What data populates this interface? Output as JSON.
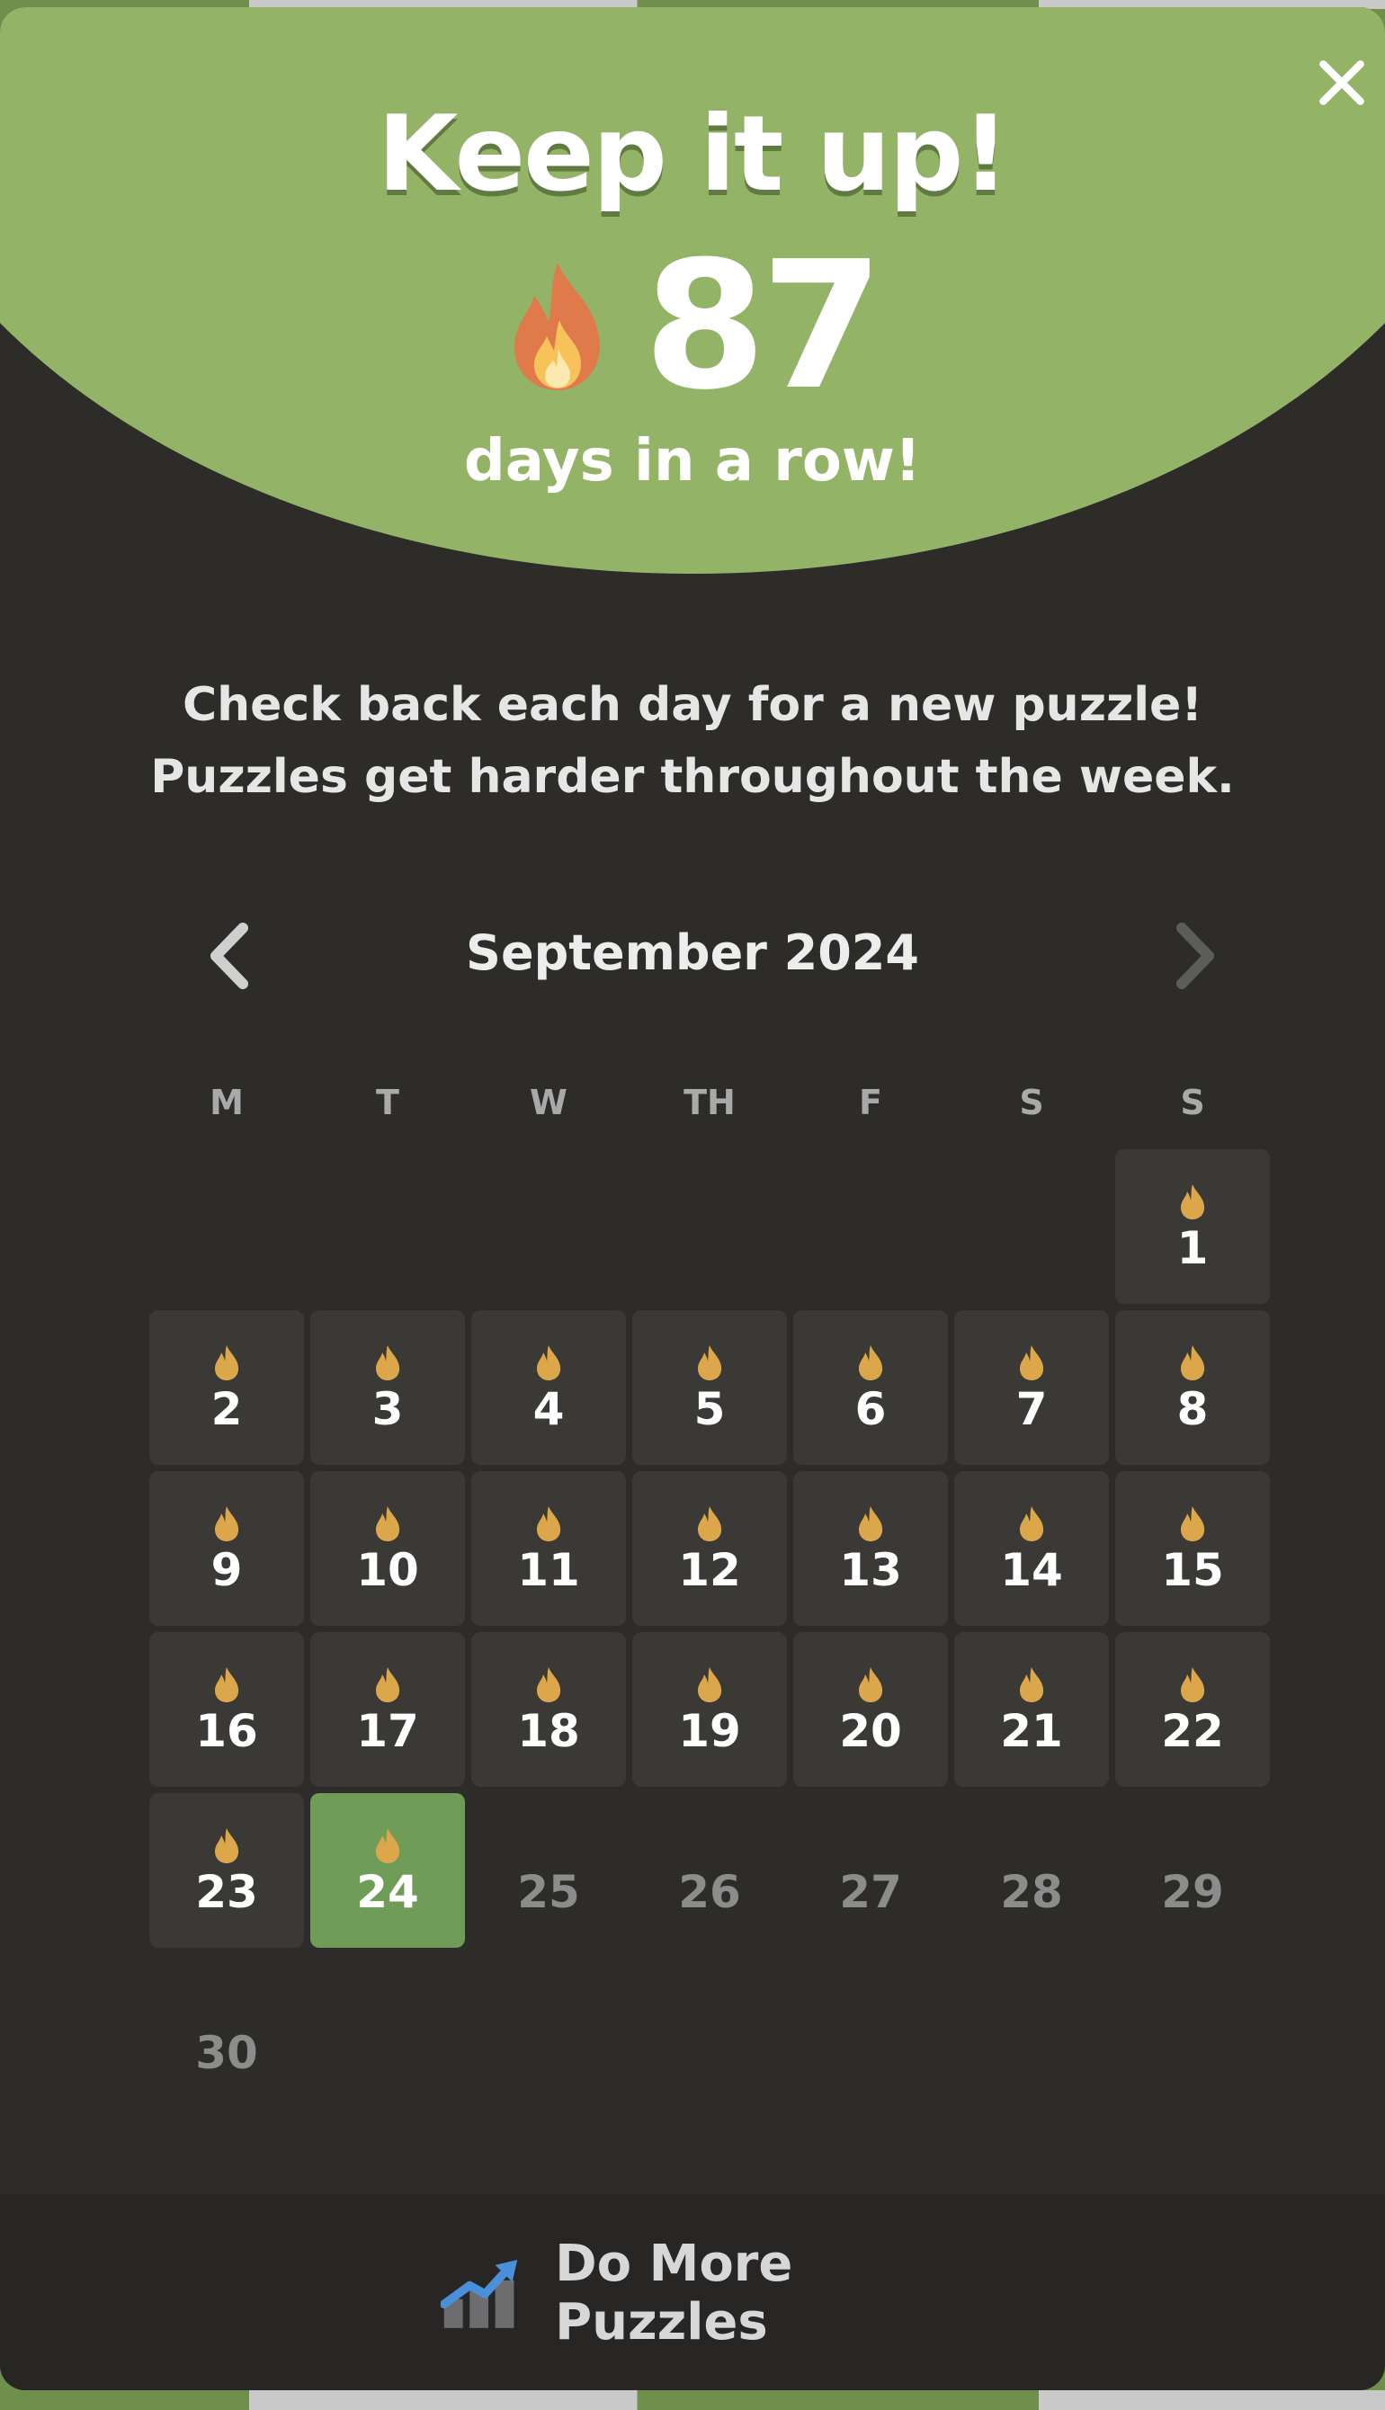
{
  "header": {
    "title": "Keep it up!",
    "streak_count": "87",
    "streak_caption": "days in a row!",
    "close_icon": "close-icon",
    "flame_icon": "flame-icon"
  },
  "description": {
    "line1": "Check back each day for a new puzzle!",
    "line2": "Puzzles get harder throughout the week."
  },
  "calendar": {
    "month_label": "September 2024",
    "prev_icon": "chevron-left-icon",
    "next_icon": "chevron-right-icon",
    "weekdays": [
      "M",
      "T",
      "W",
      "TH",
      "F",
      "S",
      "S"
    ],
    "first_weekday_index": 6,
    "days": [
      {
        "n": "1",
        "status": "played"
      },
      {
        "n": "2",
        "status": "played"
      },
      {
        "n": "3",
        "status": "played"
      },
      {
        "n": "4",
        "status": "played"
      },
      {
        "n": "5",
        "status": "played"
      },
      {
        "n": "6",
        "status": "played"
      },
      {
        "n": "7",
        "status": "played"
      },
      {
        "n": "8",
        "status": "played"
      },
      {
        "n": "9",
        "status": "played"
      },
      {
        "n": "10",
        "status": "played"
      },
      {
        "n": "11",
        "status": "played"
      },
      {
        "n": "12",
        "status": "played"
      },
      {
        "n": "13",
        "status": "played"
      },
      {
        "n": "14",
        "status": "played"
      },
      {
        "n": "15",
        "status": "played"
      },
      {
        "n": "16",
        "status": "played"
      },
      {
        "n": "17",
        "status": "played"
      },
      {
        "n": "18",
        "status": "played"
      },
      {
        "n": "19",
        "status": "played"
      },
      {
        "n": "20",
        "status": "played"
      },
      {
        "n": "21",
        "status": "played"
      },
      {
        "n": "22",
        "status": "played"
      },
      {
        "n": "23",
        "status": "played"
      },
      {
        "n": "24",
        "status": "today"
      },
      {
        "n": "25",
        "status": "future"
      },
      {
        "n": "26",
        "status": "future"
      },
      {
        "n": "27",
        "status": "future"
      },
      {
        "n": "28",
        "status": "future"
      },
      {
        "n": "29",
        "status": "future"
      },
      {
        "n": "30",
        "status": "future"
      }
    ]
  },
  "footer": {
    "button_label": "Do More Puzzles",
    "button_icon": "chart-up-icon"
  },
  "colors": {
    "hero_green": "#93b466",
    "today_green": "#6f9c57",
    "panel_bg": "#2d2c29",
    "flame_gold": "#dca64a",
    "flame_orange": "#e07a4a"
  }
}
